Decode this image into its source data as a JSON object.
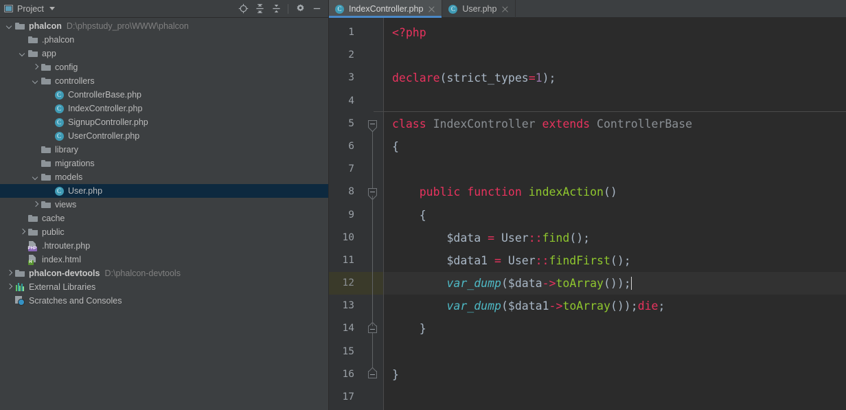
{
  "window": {
    "title": "IndexController.php"
  },
  "project_panel": {
    "label": "Project",
    "icons": [
      {
        "name": "locate-target-icon",
        "title": "Select Opened File"
      },
      {
        "name": "expand-all-icon",
        "title": "Expand All"
      },
      {
        "name": "collapse-all-icon",
        "title": "Collapse All"
      },
      {
        "name": "gear-icon",
        "title": "Settings"
      },
      {
        "name": "minimize-icon",
        "title": "Hide"
      }
    ],
    "tree": [
      {
        "label": "phalcon",
        "sub": "D:\\phpstudy_pro\\WWW\\phalcon",
        "indent": 0,
        "arrow": "expanded",
        "icon": "folder",
        "bold": true,
        "selected": false
      },
      {
        "label": ".phalcon",
        "sub": "",
        "indent": 1,
        "arrow": "none",
        "icon": "folder",
        "bold": false,
        "selected": false
      },
      {
        "label": "app",
        "sub": "",
        "indent": 1,
        "arrow": "expanded",
        "icon": "folder",
        "bold": false,
        "selected": false
      },
      {
        "label": "config",
        "sub": "",
        "indent": 2,
        "arrow": "collapsed",
        "icon": "folder",
        "bold": false,
        "selected": false
      },
      {
        "label": "controllers",
        "sub": "",
        "indent": 2,
        "arrow": "expanded",
        "icon": "folder",
        "bold": false,
        "selected": false
      },
      {
        "label": "ControllerBase.php",
        "sub": "",
        "indent": 3,
        "arrow": "none",
        "icon": "php-class",
        "bold": false,
        "selected": false
      },
      {
        "label": "IndexController.php",
        "sub": "",
        "indent": 3,
        "arrow": "none",
        "icon": "php-class",
        "bold": false,
        "selected": false
      },
      {
        "label": "SignupController.php",
        "sub": "",
        "indent": 3,
        "arrow": "none",
        "icon": "php-class",
        "bold": false,
        "selected": false
      },
      {
        "label": "UserController.php",
        "sub": "",
        "indent": 3,
        "arrow": "none",
        "icon": "php-class",
        "bold": false,
        "selected": false
      },
      {
        "label": "library",
        "sub": "",
        "indent": 2,
        "arrow": "none",
        "icon": "folder",
        "bold": false,
        "selected": false
      },
      {
        "label": "migrations",
        "sub": "",
        "indent": 2,
        "arrow": "none",
        "icon": "folder",
        "bold": false,
        "selected": false
      },
      {
        "label": "models",
        "sub": "",
        "indent": 2,
        "arrow": "expanded",
        "icon": "folder",
        "bold": false,
        "selected": false
      },
      {
        "label": "User.php",
        "sub": "",
        "indent": 3,
        "arrow": "none",
        "icon": "php-class",
        "bold": false,
        "selected": true
      },
      {
        "label": "views",
        "sub": "",
        "indent": 2,
        "arrow": "collapsed",
        "icon": "folder",
        "bold": false,
        "selected": false
      },
      {
        "label": "cache",
        "sub": "",
        "indent": 1,
        "arrow": "none",
        "icon": "folder",
        "bold": false,
        "selected": false
      },
      {
        "label": "public",
        "sub": "",
        "indent": 1,
        "arrow": "collapsed",
        "icon": "folder",
        "bold": false,
        "selected": false
      },
      {
        "label": ".htrouter.php",
        "sub": "",
        "indent": 1,
        "arrow": "none",
        "icon": "php-file",
        "bold": false,
        "selected": false
      },
      {
        "label": "index.html",
        "sub": "",
        "indent": 1,
        "arrow": "none",
        "icon": "html-file",
        "bold": false,
        "selected": false
      },
      {
        "label": "phalcon-devtools",
        "sub": "D:\\phalcon-devtools",
        "indent": 0,
        "arrow": "collapsed",
        "icon": "folder",
        "bold": true,
        "selected": false
      },
      {
        "label": "External Libraries",
        "sub": "",
        "indent": 0,
        "arrow": "collapsed",
        "icon": "libraries",
        "bold": false,
        "selected": false
      },
      {
        "label": "Scratches and Consoles",
        "sub": "",
        "indent": 0,
        "arrow": "none",
        "icon": "scratches",
        "bold": false,
        "selected": false
      }
    ]
  },
  "tabs": [
    {
      "label": "IndexController.php",
      "active": true,
      "icon": "php-class-icon"
    },
    {
      "label": "User.php",
      "active": false,
      "icon": "php-class-icon"
    }
  ],
  "editor": {
    "current_line": 12,
    "line_numbers": [
      "1",
      "2",
      "3",
      "4",
      "5",
      "6",
      "7",
      "8",
      "9",
      "10",
      "11",
      "12",
      "13",
      "14",
      "15",
      "16",
      "17"
    ],
    "lines": [
      {
        "n": 1,
        "tokens": [
          {
            "t": "<?php",
            "c": "kw"
          }
        ]
      },
      {
        "n": 2,
        "tokens": []
      },
      {
        "n": 3,
        "tokens": [
          {
            "t": "declare",
            "c": "kw"
          },
          {
            "t": "(",
            "c": "pl"
          },
          {
            "t": "strict_types",
            "c": "pl"
          },
          {
            "t": "=",
            "c": "op"
          },
          {
            "t": "1",
            "c": "num"
          },
          {
            "t": ");",
            "c": "pl"
          }
        ]
      },
      {
        "n": 4,
        "tokens": []
      },
      {
        "n": 5,
        "tokens": [
          {
            "t": "class ",
            "c": "kw"
          },
          {
            "t": "IndexController",
            "c": "cls"
          },
          {
            "t": " extends ",
            "c": "kw"
          },
          {
            "t": "ControllerBase",
            "c": "cls"
          }
        ]
      },
      {
        "n": 6,
        "tokens": [
          {
            "t": "{",
            "c": "pl"
          }
        ]
      },
      {
        "n": 7,
        "tokens": []
      },
      {
        "n": 8,
        "tokens": [
          {
            "t": "    ",
            "c": "pl"
          },
          {
            "t": "public function ",
            "c": "kw"
          },
          {
            "t": "indexAction",
            "c": "fn"
          },
          {
            "t": "()",
            "c": "pl"
          }
        ]
      },
      {
        "n": 9,
        "tokens": [
          {
            "t": "    {",
            "c": "pl"
          }
        ]
      },
      {
        "n": 10,
        "tokens": [
          {
            "t": "        $data ",
            "c": "pl"
          },
          {
            "t": "=",
            "c": "op"
          },
          {
            "t": " User",
            "c": "pl"
          },
          {
            "t": "::",
            "c": "op"
          },
          {
            "t": "find",
            "c": "fn"
          },
          {
            "t": "();",
            "c": "pl"
          }
        ]
      },
      {
        "n": 11,
        "tokens": [
          {
            "t": "        $data1 ",
            "c": "pl"
          },
          {
            "t": "=",
            "c": "op"
          },
          {
            "t": " User",
            "c": "pl"
          },
          {
            "t": "::",
            "c": "op"
          },
          {
            "t": "findFirst",
            "c": "fn"
          },
          {
            "t": "();",
            "c": "pl"
          }
        ]
      },
      {
        "n": 12,
        "tokens": [
          {
            "t": "        ",
            "c": "pl"
          },
          {
            "t": "var_dump",
            "c": "it"
          },
          {
            "t": "($data",
            "c": "pl"
          },
          {
            "t": "->",
            "c": "op"
          },
          {
            "t": "toArray",
            "c": "fn"
          },
          {
            "t": "());",
            "c": "pl"
          }
        ]
      },
      {
        "n": 13,
        "tokens": [
          {
            "t": "        ",
            "c": "pl"
          },
          {
            "t": "var_dump",
            "c": "it"
          },
          {
            "t": "($data1",
            "c": "pl"
          },
          {
            "t": "->",
            "c": "op"
          },
          {
            "t": "toArray",
            "c": "fn"
          },
          {
            "t": "());",
            "c": "pl"
          },
          {
            "t": "die",
            "c": "kw"
          },
          {
            "t": ";",
            "c": "pl"
          }
        ]
      },
      {
        "n": 14,
        "tokens": [
          {
            "t": "    }",
            "c": "pl"
          }
        ]
      },
      {
        "n": 15,
        "tokens": []
      },
      {
        "n": 16,
        "tokens": [
          {
            "t": "}",
            "c": "pl"
          }
        ]
      },
      {
        "n": 17,
        "tokens": []
      }
    ]
  },
  "colors": {
    "panel_bg": "#3c3f41",
    "editor_bg": "#2b2b2b",
    "gutter_bg": "#313335",
    "selection": "#0d293f",
    "current_line": "#323232",
    "current_line_gutter": "#3a3a2a",
    "tab_accent": "#4a88c7",
    "keyword": "#e8335e",
    "function": "#8fc72e",
    "italic_fn": "#4eb8c4",
    "number": "#9876aa",
    "classname": "#8a8f94",
    "text": "#a9b7c6"
  }
}
